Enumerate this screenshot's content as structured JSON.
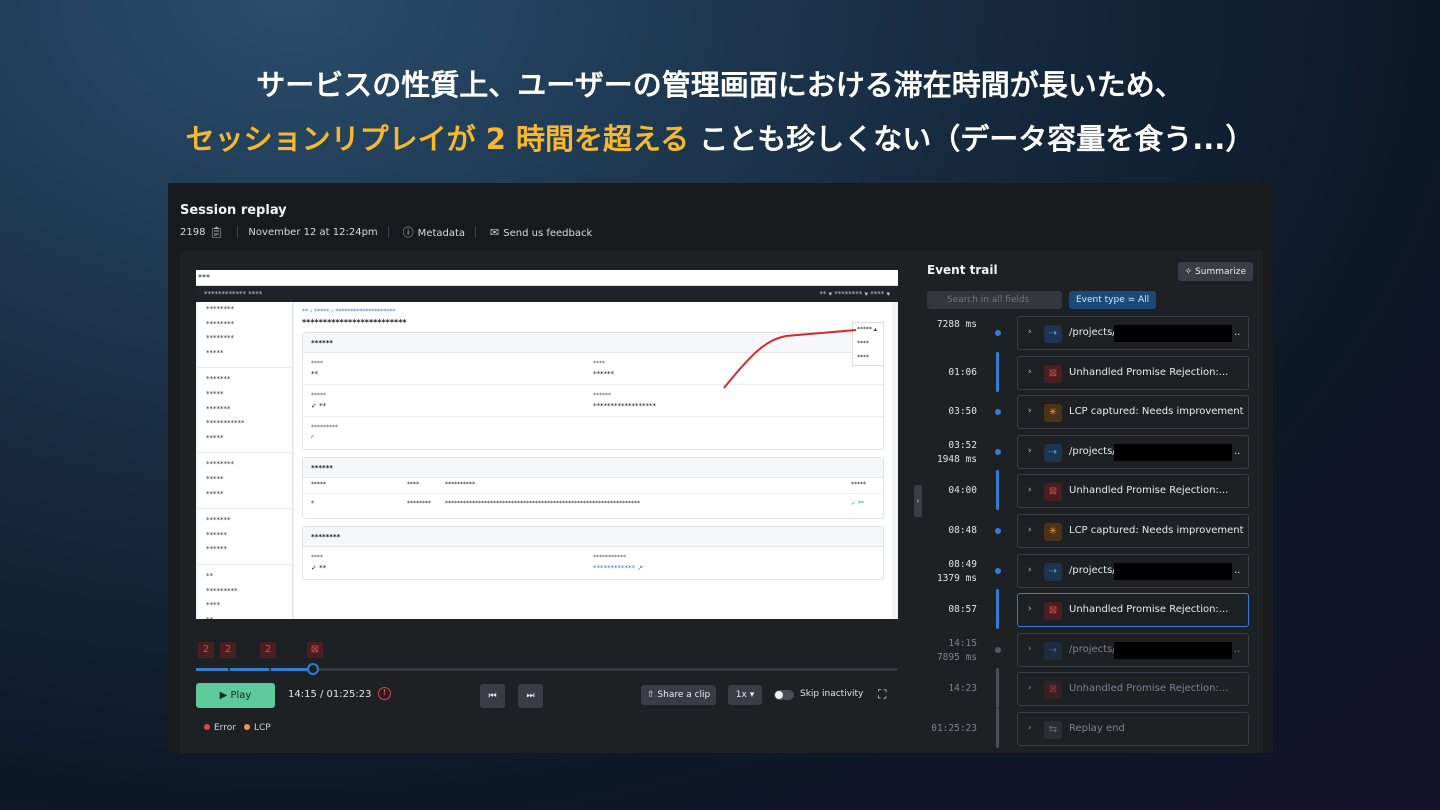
{
  "headline": {
    "line1": "サービスの性質上、ユーザーの管理画面における滞在時間が長いため、",
    "line2_highlight": "セッションリプレイが 2 時間を超える",
    "line2_rest": " ことも珍しくない（データ容量を食う...）"
  },
  "app": {
    "title": "Session replay",
    "session_id": "2198",
    "date": "November 12 at 12:24pm",
    "metadata_label": "Metadata",
    "feedback_label": "Send us feedback"
  },
  "viewport": {
    "top_text": "***",
    "nav_left": "************ ****",
    "nav_right": "** ▾  ******** ▾  **** ▾",
    "sidebar": [
      "********",
      "********",
      "********",
      "*****",
      "*******",
      "*****",
      "*******",
      "***********",
      "*****",
      "********",
      "*****",
      "*****",
      "*******",
      "******",
      "******",
      "**",
      "*********",
      "****",
      "**"
    ],
    "crumb": "** › ***** › ********************",
    "page_title": "*************************",
    "dropdown_label": "***** ▴",
    "dropdown_items": [
      "****",
      "****"
    ],
    "card1": {
      "header": "******",
      "r1c1l": "****",
      "r1c1v": "**",
      "r1c2l": "****",
      "r1c2v": "******",
      "r2c1l": "*****",
      "r2c1v": "✓ **",
      "r2c2l": "******",
      "r2c2v": "******************",
      "r3c1l": "*********",
      "r3c1v": "◜"
    },
    "card2": {
      "header": "******",
      "h1": "*****",
      "h2": "****",
      "h3": "**********",
      "h4": "*****",
      "v1": "*",
      "v2": "********",
      "v3": "*****************************************************************",
      "v4": "✓ **"
    },
    "card3": {
      "header": "********",
      "c1l": "****",
      "c1v": "✓ **",
      "c2l": "***********",
      "c2v": "************ ↗"
    }
  },
  "timeline": {
    "markers": [
      "2",
      "2",
      "2",
      "⊠"
    ],
    "play_label": "▶  Play",
    "time": "14:15 / 01:25:23",
    "warn_icon": "!",
    "prev_icon": "⏮",
    "next_icon": "⏭",
    "share_label": "⇧ Share a clip",
    "speed_label": "1x ▾",
    "skip_label": "Skip inactivity",
    "fullscreen_icon": "⛶",
    "progress_fraction": 0.167,
    "legend": [
      {
        "label": "Error",
        "color": "#e0454c"
      },
      {
        "label": "LCP",
        "color": "#f09a34"
      }
    ]
  },
  "trail": {
    "title": "Event trail",
    "summarize_label": "✧ Summarize",
    "search_placeholder": "Search in all fields",
    "filter_label": "Event type  =  All",
    "events": [
      {
        "time": "",
        "sub": "7288 ms",
        "type": "nav",
        "icon": "⇢",
        "label": "/projects/",
        "redacted": true,
        "dots": "..",
        "dim": false
      },
      {
        "time": "01:06",
        "sub": "",
        "type": "err",
        "icon": "⊠",
        "label": "Unhandled Promise Rejection:...",
        "redacted": false,
        "dots": "",
        "dim": false
      },
      {
        "time": "03:50",
        "sub": "",
        "type": "lcp",
        "icon": "✳",
        "label": "LCP captured: Needs improvement",
        "redacted": false,
        "dots": "",
        "dim": false
      },
      {
        "time": "03:52",
        "sub": "1948 ms",
        "type": "nav",
        "icon": "⇢",
        "label": "/projects/",
        "redacted": true,
        "dots": "..",
        "dim": false
      },
      {
        "time": "04:00",
        "sub": "",
        "type": "err",
        "icon": "⊠",
        "label": "Unhandled Promise Rejection:...",
        "redacted": false,
        "dots": "",
        "dim": false
      },
      {
        "time": "08:48",
        "sub": "",
        "type": "lcp",
        "icon": "✳",
        "label": "LCP captured: Needs improvement",
        "redacted": false,
        "dots": "",
        "dim": false
      },
      {
        "time": "08:49",
        "sub": "1379 ms",
        "type": "nav",
        "icon": "⇢",
        "label": "/projects/",
        "redacted": true,
        "dots": "..",
        "dim": false
      },
      {
        "time": "08:57",
        "sub": "",
        "type": "err",
        "icon": "⊠",
        "label": "Unhandled Promise Rejection:...",
        "redacted": false,
        "dots": "",
        "dim": false,
        "selected": true
      },
      {
        "time": "14:15",
        "sub": "7895 ms",
        "type": "nav",
        "icon": "⇢",
        "label": "/projects/",
        "redacted": true,
        "dots": "..",
        "dim": true
      },
      {
        "time": "14:23",
        "sub": "",
        "type": "err",
        "icon": "⊠",
        "label": "Unhandled Promise Rejection:...",
        "redacted": false,
        "dots": "",
        "dim": true
      },
      {
        "time": "01:25:23",
        "sub": "",
        "type": "end",
        "icon": "⇆",
        "label": "Replay end",
        "redacted": false,
        "dots": "",
        "dim": true
      }
    ]
  }
}
